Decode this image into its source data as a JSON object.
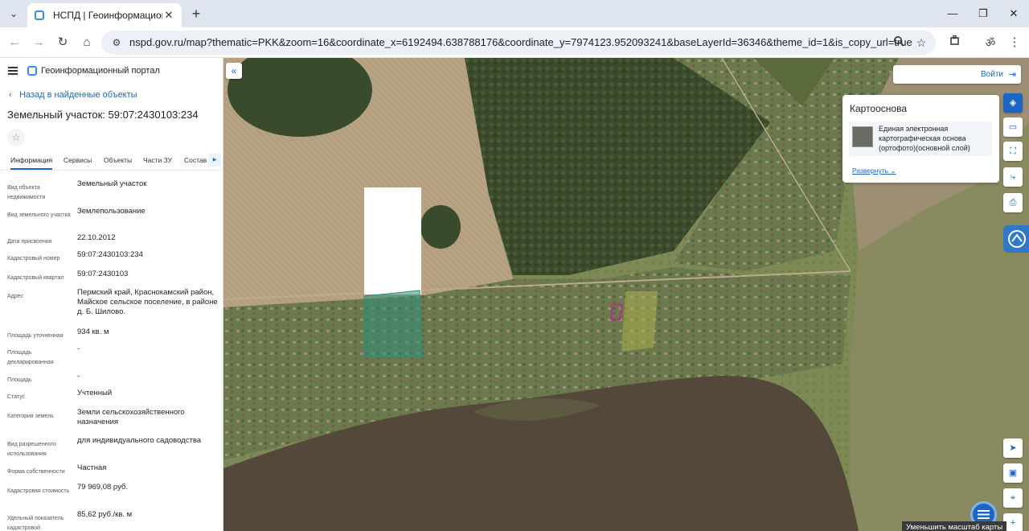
{
  "browser": {
    "tab_title": "НСПД | Геоинформационный",
    "url": "nspd.gov.ru/map?thematic=PKK&zoom=16&coordinate_x=6192494.638788176&coordinate_y=7974123.952093241&baseLayerId=36346&theme_id=1&is_copy_url=true"
  },
  "panel": {
    "portal_title": "Геоинформационный портал",
    "back_label": "Назад в найденные объекты",
    "object_title": "Земельный участок: 59:07:2430103:234",
    "tabs": [
      "Информация",
      "Сервисы",
      "Объекты",
      "Части ЗУ",
      "Состав"
    ],
    "properties": [
      {
        "label": "Вид объекта недвижимости",
        "value": "Земельный участок"
      },
      {
        "label": "Вид земельного участка",
        "value": "Землепользование"
      },
      {
        "label": "Дата присвоения",
        "value": "22.10.2012"
      },
      {
        "label": "Кадастровый номер",
        "value": "59:07:2430103:234"
      },
      {
        "label": "Кадастровый квартал",
        "value": "59:07:2430103"
      },
      {
        "label": "Адрес",
        "value": "Пермский край, Краснокамский район, Майское сельское поселение, в районе д. Б. Шилово."
      },
      {
        "label": "Площадь уточненная",
        "value": "934 кв. м"
      },
      {
        "label": "Площадь декларированная",
        "value": "-"
      },
      {
        "label": "Площадь",
        "value": "-"
      },
      {
        "label": "Статус",
        "value": "Учтенный"
      },
      {
        "label": "Категория земель",
        "value": "Земли сельскохозяйственного назначения"
      },
      {
        "label": "Вид разрешенного использования",
        "value": "для индивидуального садоводства"
      },
      {
        "label": "Форма собственности",
        "value": "Частная"
      },
      {
        "label": "Кадастровая стоимость",
        "value": "79 969,08 руб."
      },
      {
        "label": "Удельный показатель кадастровой",
        "value": "85,62 руб./кв. м"
      }
    ]
  },
  "map": {
    "login_label": "Войти",
    "basemap": {
      "title": "Картооснова",
      "layer_name": "Единая электронная картографическая основа (ортофото)(основной слой)",
      "expand_label": "Развернуть"
    },
    "tooltip": "Уменьшить масштаб карты"
  },
  "colors": {
    "accent": "#1a66c2",
    "parcel_outline": "#b0308c",
    "quarter_overlay": "#2e8f7a"
  }
}
